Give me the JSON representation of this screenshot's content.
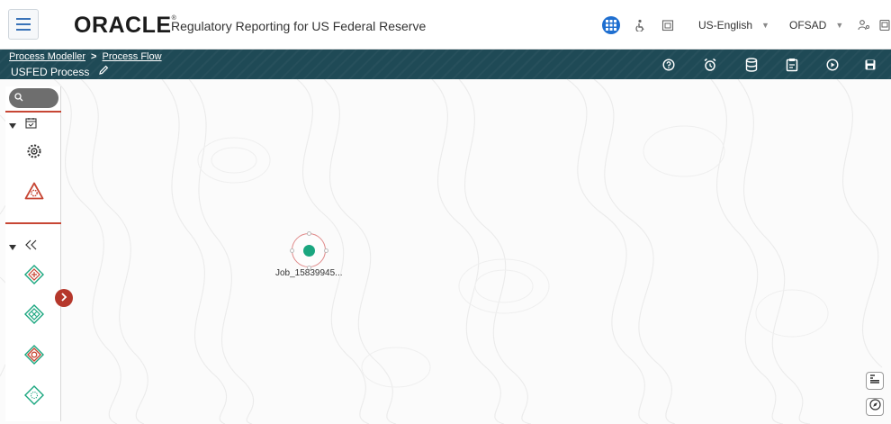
{
  "header": {
    "brand": "ORACLE",
    "brand_mark": "®",
    "app_title": "Regulatory Reporting for US Federal Reserve",
    "language": "US-English",
    "user": "OFSAD"
  },
  "banner": {
    "breadcrumb": [
      "Process Modeller",
      "Process Flow"
    ],
    "breadcrumb_separator": ">",
    "process_name": "USFED Process"
  },
  "canvas": {
    "node_label": "Job_15839945..."
  },
  "colors": {
    "banner": "#1f4a56",
    "accent_red": "#c74634",
    "node_green": "#1aa67f",
    "grid_blue": "#1f6fd0"
  }
}
